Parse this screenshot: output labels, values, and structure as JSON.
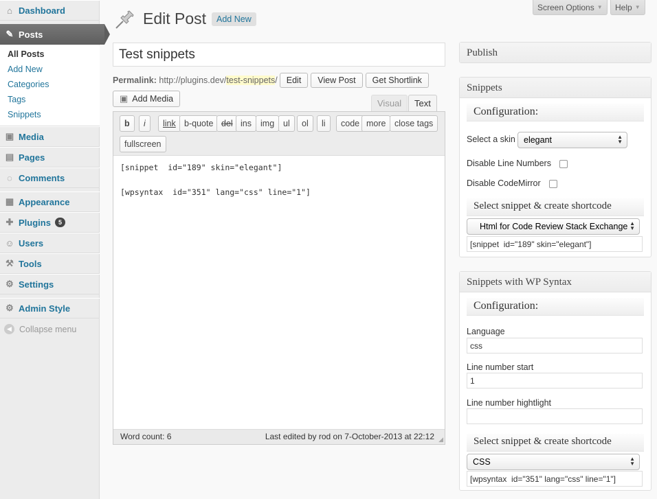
{
  "top": {
    "screen_options": "Screen Options",
    "help": "Help"
  },
  "sidebar": {
    "dashboard": "Dashboard",
    "posts": "Posts",
    "sub": [
      "All Posts",
      "Add New",
      "Categories",
      "Tags",
      "Snippets"
    ],
    "media": "Media",
    "pages": "Pages",
    "comments": "Comments",
    "appearance": "Appearance",
    "plugins": "Plugins",
    "plugins_badge": "5",
    "users": "Users",
    "tools": "Tools",
    "settings": "Settings",
    "admin_style": "Admin Style",
    "collapse": "Collapse menu"
  },
  "header": {
    "title": "Edit Post",
    "add_new": "Add New"
  },
  "post": {
    "title": "Test snippets",
    "permalink_label": "Permalink:",
    "permalink_base": "http://plugins.dev/",
    "permalink_slug": "test-snippets",
    "permalink_trail": "/",
    "edit": "Edit",
    "view_post": "View Post",
    "get_shortlink": "Get Shortlink"
  },
  "editor": {
    "add_media": "Add Media",
    "tab_visual": "Visual",
    "tab_text": "Text",
    "buttons": [
      "b",
      "i",
      "link",
      "b-quote",
      "del",
      "ins",
      "img",
      "ul",
      "ol",
      "li",
      "code",
      "more",
      "close tags",
      "fullscreen"
    ],
    "content": [
      "[snippet  id=\"189\" skin=\"elegant\"]",
      "[wpsyntax  id=\"351\" lang=\"css\" line=\"1\"]"
    ],
    "word_count": "Word count: 6",
    "last_edited": "Last edited by rod on 7-October-2013 at 22:12"
  },
  "publish": {
    "title": "Publish"
  },
  "snippets": {
    "title": "Snippets",
    "config": "Configuration:",
    "skin_label": "Select a skin",
    "skin_value": "elegant",
    "disable_line_numbers": "Disable Line Numbers",
    "disable_codemirror": "Disable CodeMirror",
    "select_heading": "Select snippet & create shortcode",
    "snippet_value": "Html for Code Review Stack Exchange",
    "shortcode": "[snippet  id=\"189\" skin=\"elegant\"]"
  },
  "wpsyntax": {
    "title": "Snippets with WP Syntax",
    "config": "Configuration:",
    "language_label": "Language",
    "language_value": "css",
    "line_start_label": "Line number start",
    "line_start_value": "1",
    "line_highlight_label": "Line number hightlight",
    "line_highlight_value": "",
    "select_heading": "Select snippet & create shortcode",
    "snippet_value": "CSS",
    "shortcode": "[wpsyntax  id=\"351\" lang=\"css\" line=\"1\"]"
  }
}
